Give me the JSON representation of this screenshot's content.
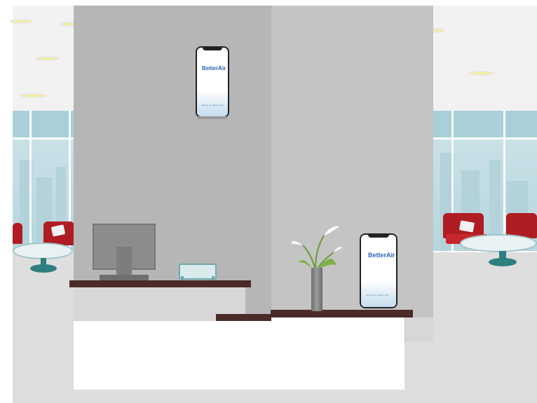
{
  "scene": {
    "wall_device": {
      "brand": "BetterAir",
      "tagline": "Better air, Better life"
    },
    "desk_device": {
      "brand": "BetterAir",
      "tagline": "Better air, Better life"
    }
  },
  "colors": {
    "wall_gray": "#b6b6b6",
    "accent_blue": "#2a66b8",
    "sofa_red": "#b01c23",
    "desk_brown": "#4a2b28",
    "window_blue": "#a9cfd8"
  }
}
